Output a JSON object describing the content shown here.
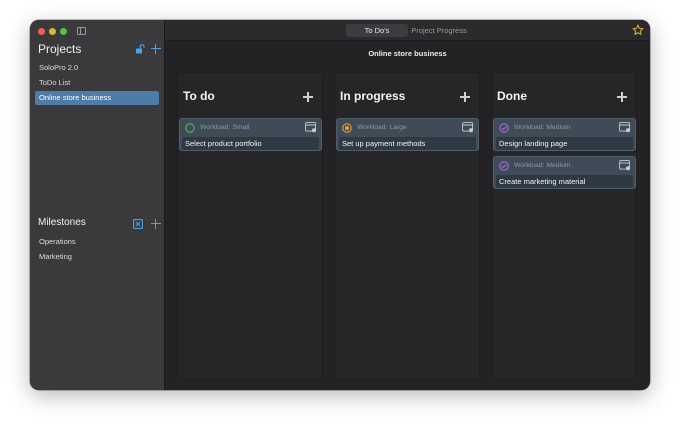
{
  "sidebar": {
    "projects_title": "Projects",
    "projects": [
      {
        "label": "SoloPro 2.0"
      },
      {
        "label": "ToDo List"
      },
      {
        "label": "Online store business"
      }
    ],
    "milestones_title": "Milestones",
    "milestones": [
      {
        "label": "Operations"
      },
      {
        "label": "Marketing"
      }
    ]
  },
  "tabs": [
    {
      "label": "To Do's"
    },
    {
      "label": "Project Progress"
    }
  ],
  "board": {
    "title": "Online store business",
    "columns": [
      {
        "title": "To do",
        "cards": [
          {
            "workload": "Workload: Small",
            "title": "Select product portfolio",
            "status_color": "#58b85e"
          }
        ]
      },
      {
        "title": "In progress",
        "cards": [
          {
            "workload": "Workload: Large",
            "title": "Set up payment methods",
            "status_color": "#e8a13a"
          }
        ]
      },
      {
        "title": "Done",
        "cards": [
          {
            "workload": "Workload: Medium",
            "title": "Design landing page",
            "status_color": "#a36ce0"
          },
          {
            "workload": "Workload: Medium",
            "title": "Create marketing material",
            "status_color": "#a36ce0"
          }
        ]
      }
    ]
  },
  "colors": {
    "accent": "#4ea2e4",
    "selected_project": "#4e7ca6",
    "star": "#e7bf45"
  },
  "icons": {
    "projects_tools": [
      "lock-open-icon",
      "plus-icon"
    ],
    "milestones_tools": [
      "close-box-icon",
      "plus-icon"
    ],
    "card_action": "edit-card-icon",
    "favorite": "star-icon"
  }
}
